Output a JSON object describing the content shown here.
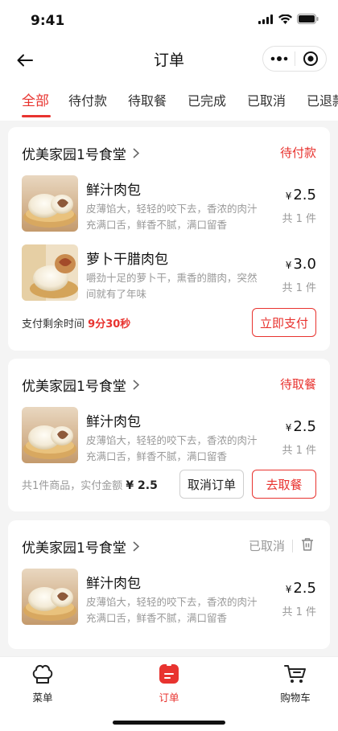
{
  "status_bar": {
    "time": "9:41"
  },
  "nav": {
    "title": "订单"
  },
  "tabs": [
    {
      "label": "全部",
      "active": true
    },
    {
      "label": "待付款",
      "active": false
    },
    {
      "label": "待取餐",
      "active": false
    },
    {
      "label": "已完成",
      "active": false
    },
    {
      "label": "已取消",
      "active": false
    },
    {
      "label": "已退款",
      "active": false
    }
  ],
  "orders": [
    {
      "shop": "优美家园1号食堂",
      "status": "待付款",
      "items": [
        {
          "name": "鲜汁肉包",
          "desc": "皮薄馅大，轻轻的咬下去，香浓的肉汁充满口舌，鲜香不腻，满口留香",
          "currency": "¥",
          "price": "2.5",
          "count": "共 1 件"
        },
        {
          "name": "萝卜干腊肉包",
          "desc": "嚼劲十足的萝卜干，熏香的腊肉，突然间就有了年味",
          "currency": "¥",
          "price": "3.0",
          "count": "共 1 件"
        }
      ],
      "footer": {
        "remaining_label": "支付剩余时间",
        "remaining_time": "9分30秒",
        "pay_button": "立即支付"
      }
    },
    {
      "shop": "优美家园1号食堂",
      "status": "待取餐",
      "items": [
        {
          "name": "鲜汁肉包",
          "desc": "皮薄馅大，轻轻的咬下去，香浓的肉汁充满口舌，鲜香不腻，满口留香",
          "currency": "¥",
          "price": "2.5",
          "count": "共 1 件"
        }
      ],
      "footer": {
        "summary": "共1件商品，实付金额",
        "amount": "¥ 2.5",
        "cancel_button": "取消订单",
        "pickup_button": "去取餐"
      }
    },
    {
      "shop": "优美家园1号食堂",
      "status": "已取消",
      "items": [
        {
          "name": "鲜汁肉包",
          "desc": "皮薄馅大，轻轻的咬下去，香浓的肉汁充满口舌，鲜香不腻，满口留香",
          "currency": "¥",
          "price": "2.5",
          "count": "共 1 件"
        }
      ]
    }
  ],
  "bottom_nav": [
    {
      "label": "菜单",
      "icon": "chef-hat-icon",
      "active": false
    },
    {
      "label": "订单",
      "icon": "order-list-icon",
      "active": true
    },
    {
      "label": "购物车",
      "icon": "cart-icon",
      "active": false
    }
  ],
  "colors": {
    "accent": "#e8332f",
    "background": "#f4f4f4"
  }
}
